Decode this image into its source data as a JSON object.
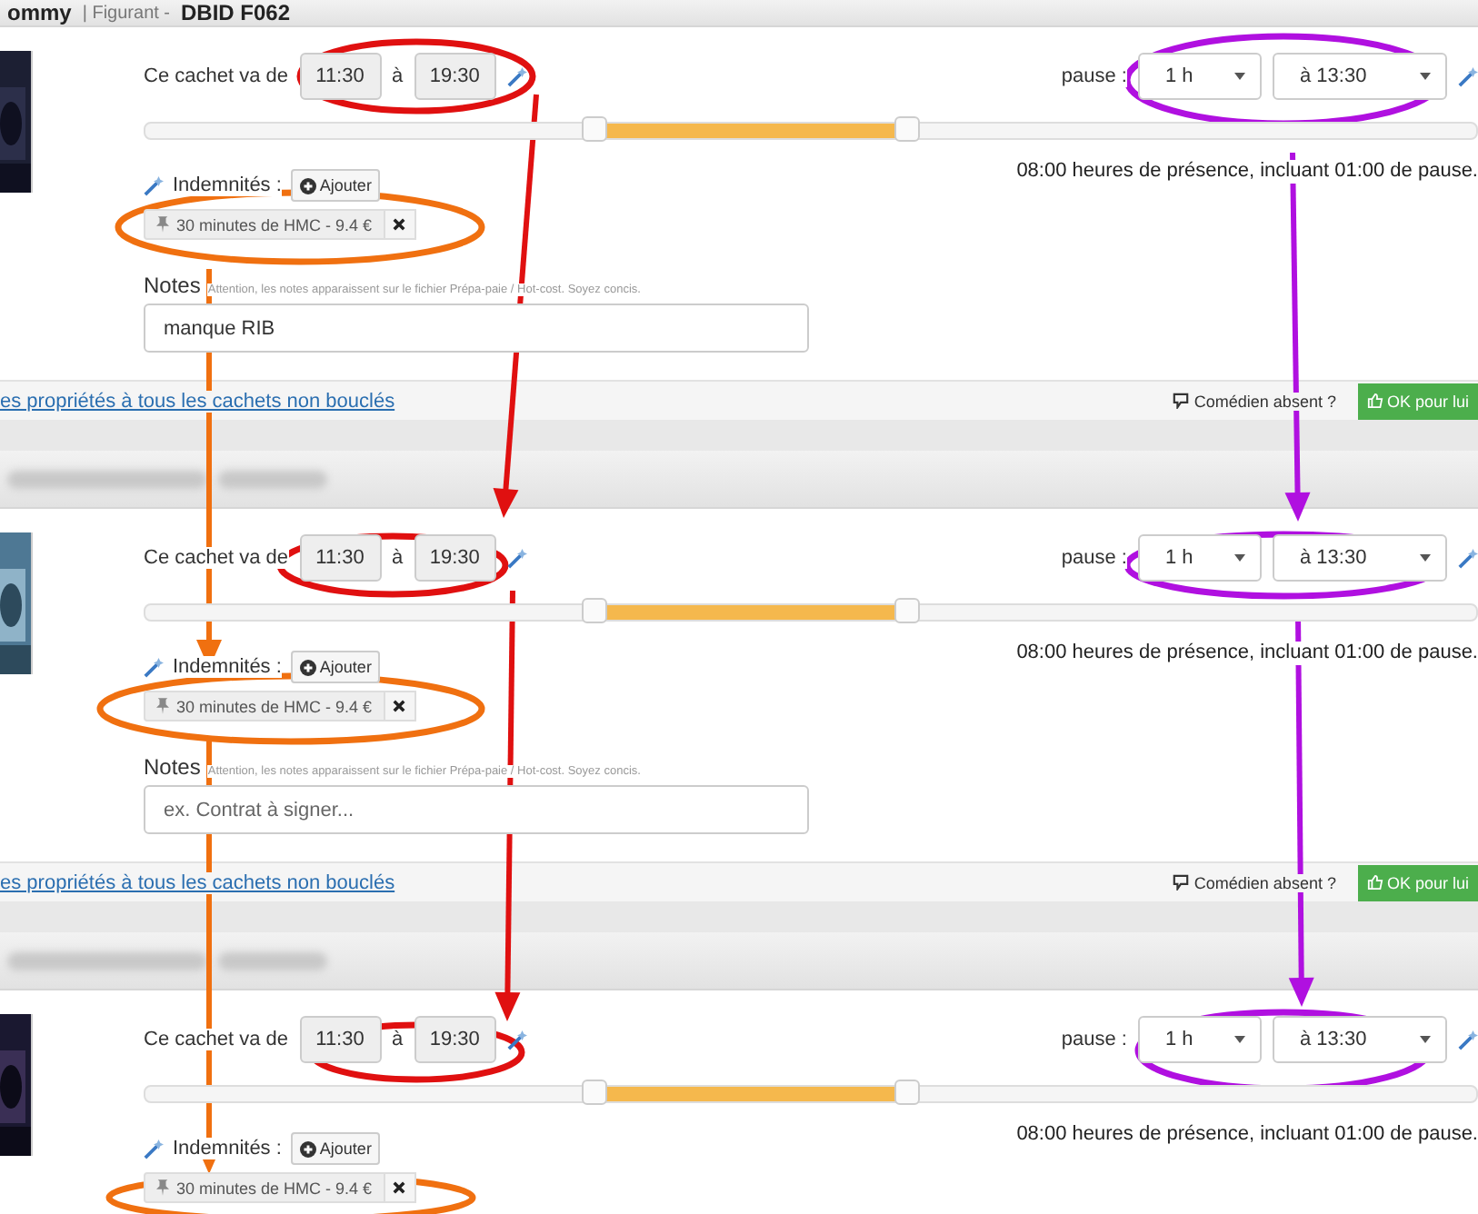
{
  "entries": [
    {
      "header": {
        "name": "ommy",
        "role": "| Figurant -",
        "code": "DBID F062"
      },
      "time_label": "Ce cachet va de",
      "start": "11:30",
      "sep": "à",
      "end": "19:30",
      "pause_label": "pause :",
      "pause_duration": "1 h",
      "pause_at": "à 13:30",
      "slider": [
        {
          "level": 0.338
        },
        {
          "level": 0.572
        }
      ],
      "presence": "08:00 heures de présence, incluant 01:00 de pause.",
      "indemnites_label": "Indemnités :",
      "add_button": "Ajouter",
      "tags": [
        {
          "text": "30 minutes de HMC - 9.4 €"
        }
      ],
      "notes": {
        "label": "Notes",
        "hint": "Attention, les notes apparaissent sur le fichier Prépa-paie / Hot-cost. Soyez concis.",
        "value": "manque RIB"
      },
      "footer": {
        "link": "es propriétés à tous les cachets non bouclés",
        "absent": "Comédien absent ?",
        "ok": "OK pour lui"
      }
    },
    {
      "time_label": "Ce cachet va de",
      "start": "11:30",
      "sep": "à",
      "end": "19:30",
      "pause_label": "pause :",
      "pause_duration": "1 h",
      "pause_at": "à 13:30",
      "slider": [
        {
          "level": 0.338
        },
        {
          "level": 0.572
        }
      ],
      "presence": "08:00 heures de présence, incluant 01:00 de pause.",
      "indemnites_label": "Indemnités :",
      "add_button": "Ajouter",
      "tags": [
        {
          "text": "30 minutes de HMC - 9.4 €"
        }
      ],
      "notes": {
        "label": "Notes",
        "hint": "Attention, les notes apparaissent sur le fichier Prépa-paie / Hot-cost. Soyez concis.",
        "placeholder": "ex. Contrat à signer..."
      },
      "footer": {
        "link": "es propriétés à tous les cachets non bouclés",
        "absent": "Comédien absent ?",
        "ok": "OK pour lui"
      }
    },
    {
      "time_label": "Ce cachet va de",
      "start": "11:30",
      "sep": "à",
      "end": "19:30",
      "pause_label": "pause :",
      "pause_duration": "1 h",
      "pause_at": "à 13:30",
      "slider": [
        {
          "level": 0.338
        },
        {
          "level": 0.572
        }
      ],
      "presence": "08:00 heures de présence, incluant 01:00 de pause.",
      "indemnites_label": "Indemnités :",
      "add_button": "Ajouter",
      "tags": [
        {
          "text": "30 minutes de HMC - 9.4 €"
        }
      ]
    }
  ]
}
